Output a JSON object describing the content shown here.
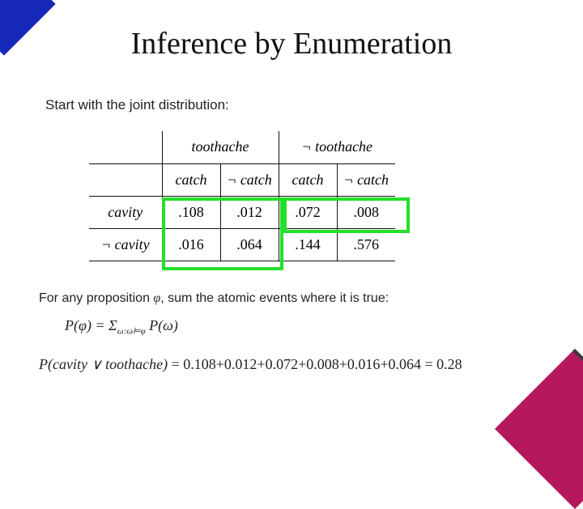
{
  "title": "Inference by Enumeration",
  "subtitle": "Start with the joint distribution:",
  "table": {
    "col_group_a": "toothache",
    "col_group_b": "¬ toothache",
    "cols": [
      "catch",
      "¬ catch",
      "catch",
      "¬ catch"
    ],
    "row1_label": "cavity",
    "row2_label": "¬ cavity",
    "r1": [
      ".108",
      ".012",
      ".072",
      ".008"
    ],
    "r2": [
      ".016",
      ".064",
      ".144",
      ".576"
    ]
  },
  "para2_a": "For any proposition ",
  "para2_phi": "φ",
  "para2_b": ", sum the atomic events where it is true:",
  "formula": {
    "lhs": "P(φ) = Σ",
    "sub": "ω:ω⊨φ",
    "rhs": " P(ω)"
  },
  "eq": {
    "lhs": "P(cavity ∨ toothache) ",
    "rhs": "= 0.108+0.012+0.072+0.008+0.016+0.064 = 0.28"
  },
  "chart_data": {
    "type": "table",
    "title": "Joint distribution over cavity, toothache, catch",
    "columns": [
      "toothache ∧ catch",
      "toothache ∧ ¬catch",
      "¬toothache ∧ catch",
      "¬toothache ∧ ¬catch"
    ],
    "rows": [
      "cavity",
      "¬cavity"
    ],
    "values": [
      [
        0.108,
        0.012,
        0.072,
        0.008
      ],
      [
        0.016,
        0.064,
        0.144,
        0.576
      ]
    ],
    "highlighted_cells": [
      [
        0,
        0
      ],
      [
        0,
        1
      ],
      [
        0,
        2
      ],
      [
        0,
        3
      ],
      [
        1,
        0
      ],
      [
        1,
        1
      ]
    ],
    "derived": {
      "P(cavity ∨ toothache)": 0.28
    }
  }
}
